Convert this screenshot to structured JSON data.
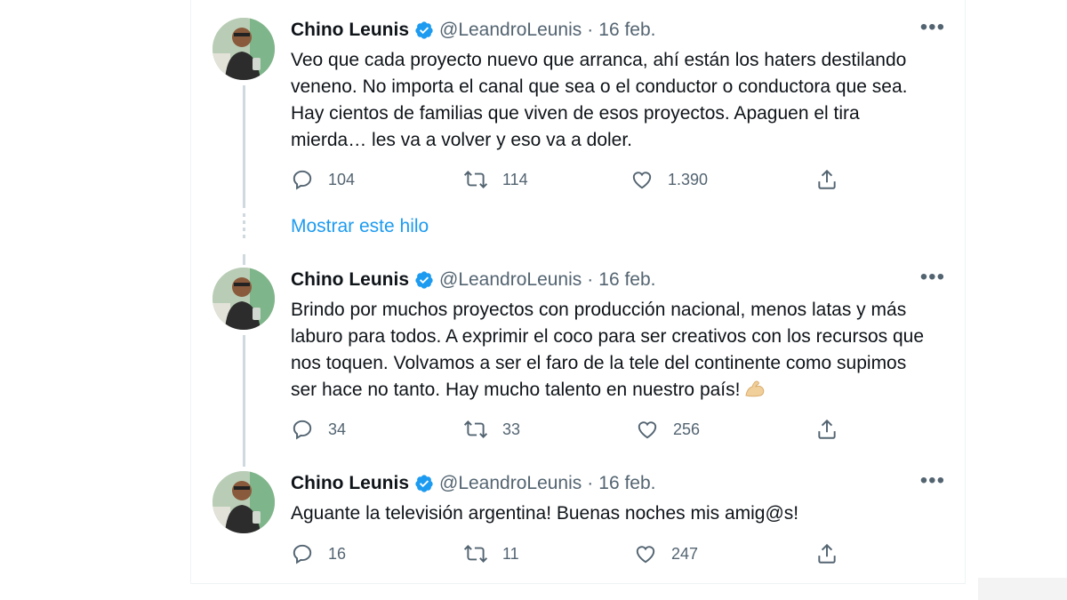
{
  "tweets": [
    {
      "name": "Chino Leunis",
      "handle": "@LeandroLeunis",
      "separator": "·",
      "date": "16 feb.",
      "text": "Veo que cada proyecto nuevo que arranca, ahí están los haters destilando veneno. No importa el canal que sea o el conductor o conductora que sea. Hay cientos de familias que viven de esos proyectos. Apaguen el tira mierda… les va a volver y eso va a doler.",
      "replies": "104",
      "retweets": "114",
      "likes": "1.390"
    },
    {
      "name": "Chino Leunis",
      "handle": "@LeandroLeunis",
      "separator": "·",
      "date": "16 feb.",
      "text": "Brindo por muchos proyectos con producción nacional, menos latas y más laburo para todos. A exprimir el coco para ser creativos con los recursos que nos toquen. Volvamos a ser el faro de la tele del continente como supimos ser hace no tanto. Hay mucho talento en nuestro país!",
      "emoji": "flexed-biceps-icon",
      "replies": "34",
      "retweets": "33",
      "likes": "256"
    },
    {
      "name": "Chino Leunis",
      "handle": "@LeandroLeunis",
      "separator": "·",
      "date": "16 feb.",
      "text": "Aguante la televisión argentina! Buenas noches mis amig@s!",
      "replies": "16",
      "retweets": "11",
      "likes": "247"
    }
  ],
  "show_thread_label": "Mostrar este hilo",
  "more_label": "•••",
  "colors": {
    "accent": "#1d9bf0",
    "secondary_text": "#536471",
    "thread_line": "#cfd9de"
  },
  "icons": [
    "reply-icon",
    "retweet-icon",
    "like-icon",
    "share-icon",
    "verified-badge-icon",
    "more-icon"
  ]
}
